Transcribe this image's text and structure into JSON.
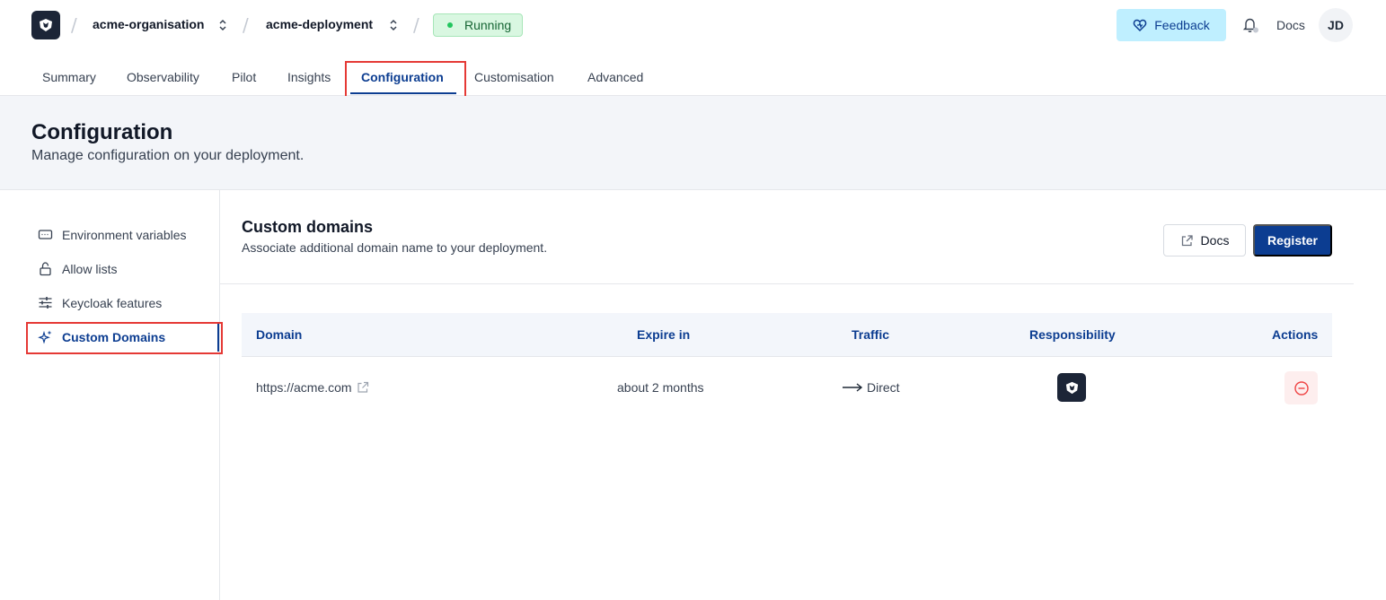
{
  "topbar": {
    "organisation": "acme-organisation",
    "deployment": "acme-deployment",
    "status": "Running",
    "feedback_label": "Feedback",
    "docs_label": "Docs",
    "avatar_initials": "JD"
  },
  "tabs": [
    {
      "label": "Summary"
    },
    {
      "label": "Observability"
    },
    {
      "label": "Pilot"
    },
    {
      "label": "Insights"
    },
    {
      "label": "Configuration"
    },
    {
      "label": "Customisation"
    },
    {
      "label": "Advanced"
    }
  ],
  "page": {
    "title": "Configuration",
    "subtitle": "Manage configuration on your deployment."
  },
  "sidebar": {
    "items": [
      {
        "label": "Environment variables",
        "icon": "env-variables-icon"
      },
      {
        "label": "Allow lists",
        "icon": "lock-icon"
      },
      {
        "label": "Keycloak features",
        "icon": "sliders-icon"
      },
      {
        "label": "Custom Domains",
        "icon": "sparkles-icon"
      }
    ]
  },
  "content": {
    "title": "Custom domains",
    "subtitle": "Associate additional domain name to your deployment.",
    "docs_label": "Docs",
    "register_label": "Register"
  },
  "table": {
    "headers": [
      "Domain",
      "Expire in",
      "Traffic",
      "Responsibility",
      "Actions"
    ],
    "rows": [
      {
        "domain": "https://acme.com",
        "expire": "about 2 months",
        "traffic": "Direct"
      }
    ]
  },
  "colors": {
    "brand": "#0c3d91",
    "running": "#22c55e",
    "highlight": "#e53935",
    "danger": "#ef4444"
  }
}
